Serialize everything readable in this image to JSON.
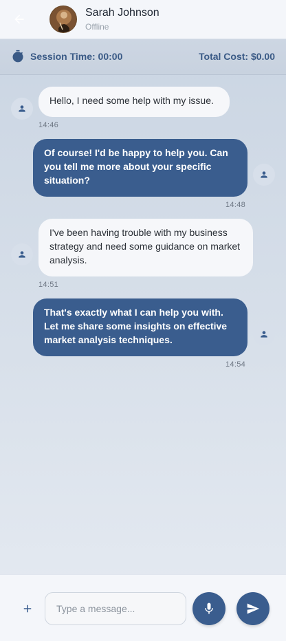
{
  "header": {
    "contact_name": "Sarah Johnson",
    "status": "Offline"
  },
  "session": {
    "time_label": "Session Time: 00:00",
    "cost_label": "Total Cost: $0.00"
  },
  "messages": [
    {
      "direction": "incoming",
      "text": "Hello, I need some help with my issue.",
      "time": "14:46"
    },
    {
      "direction": "outgoing",
      "text": "Of course! I'd be happy to help you. Can you tell me more about your specific situation?",
      "time": "14:48"
    },
    {
      "direction": "incoming",
      "text": "I've been having trouble with my business strategy and need some guidance on market analysis.",
      "time": "14:51"
    },
    {
      "direction": "outgoing",
      "text": "That's exactly what I can help you with. Let me share some insights on effective market analysis techniques.",
      "time": "14:54"
    }
  ],
  "composer": {
    "placeholder": "Type a message..."
  },
  "icons": {
    "back": "arrow-left-icon",
    "timer": "stopwatch-icon",
    "user": "person-icon",
    "add": "plus-icon",
    "mic": "microphone-icon",
    "send": "send-icon"
  },
  "colors": {
    "accent": "#3a5d8e",
    "accent_text": "#3a5a86",
    "incoming_bubble": "#f6f7fa"
  }
}
